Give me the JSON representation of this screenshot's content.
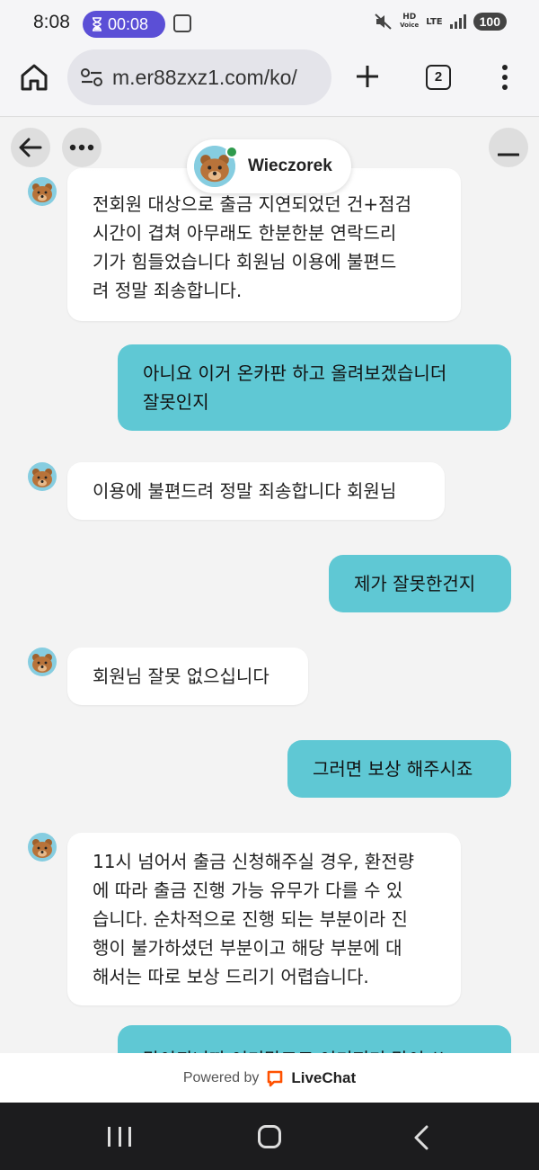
{
  "status_bar": {
    "time": "8:08",
    "timer": "00:08",
    "hd_label": "HD",
    "voice_label": "Voice",
    "lte_label": "LTE",
    "battery": "100"
  },
  "browser": {
    "url": "m.er88zxz1.com/ko/",
    "tab_count": "2"
  },
  "chat_header": {
    "agent_name": "Wieczorek",
    "online_color": "#2e9a4c"
  },
  "messages": [
    {
      "sender": "agent",
      "lines": [
        "전회원 대상으로 출금 지연되었던 건+점검",
        "시간이 겹쳐 아무래도 한분한분 연락드리",
        "기가 힘들었습니다 회원님 이용에 불편드",
        "려 정말 죄송합니다."
      ]
    },
    {
      "sender": "user",
      "lines": [
        "아니요 이거 온카판 하고 올려보겠습니더",
        "잘못인지"
      ]
    },
    {
      "sender": "agent",
      "lines": [
        "이용에 불편드려 정말 죄송합니다 회원님"
      ]
    },
    {
      "sender": "user",
      "lines": [
        "제가 잘못한건지"
      ]
    },
    {
      "sender": "agent",
      "lines": [
        "회원님 잘못 없으십니다"
      ]
    },
    {
      "sender": "user",
      "lines": [
        "그러면 보상 해주시죠"
      ]
    },
    {
      "sender": "agent",
      "lines": [
        "11시 넘어서 출금 신청해주실 경우, 환전량",
        "에 따라 출금 진행 가능 유무가 다를 수 있",
        "습니다. 순차적으로 진행 되는 부분이라 진",
        "행이 불가하셨던 부분이고 해당 부분에 대",
        "해서는 따로 보상 드리기 어렵습니다."
      ]
    },
    {
      "sender": "user",
      "lines": [
        "말이되니까 여기말고도 여기저기 많이 쓰"
      ]
    }
  ],
  "footer": {
    "powered_by": "Powered by",
    "brand": "LiveChat",
    "brand_color": "#ff5100"
  },
  "colors": {
    "user_bubble": "#5fc8d4",
    "agent_bubble": "#ffffff",
    "timer_pill": "#5b4fd6"
  }
}
